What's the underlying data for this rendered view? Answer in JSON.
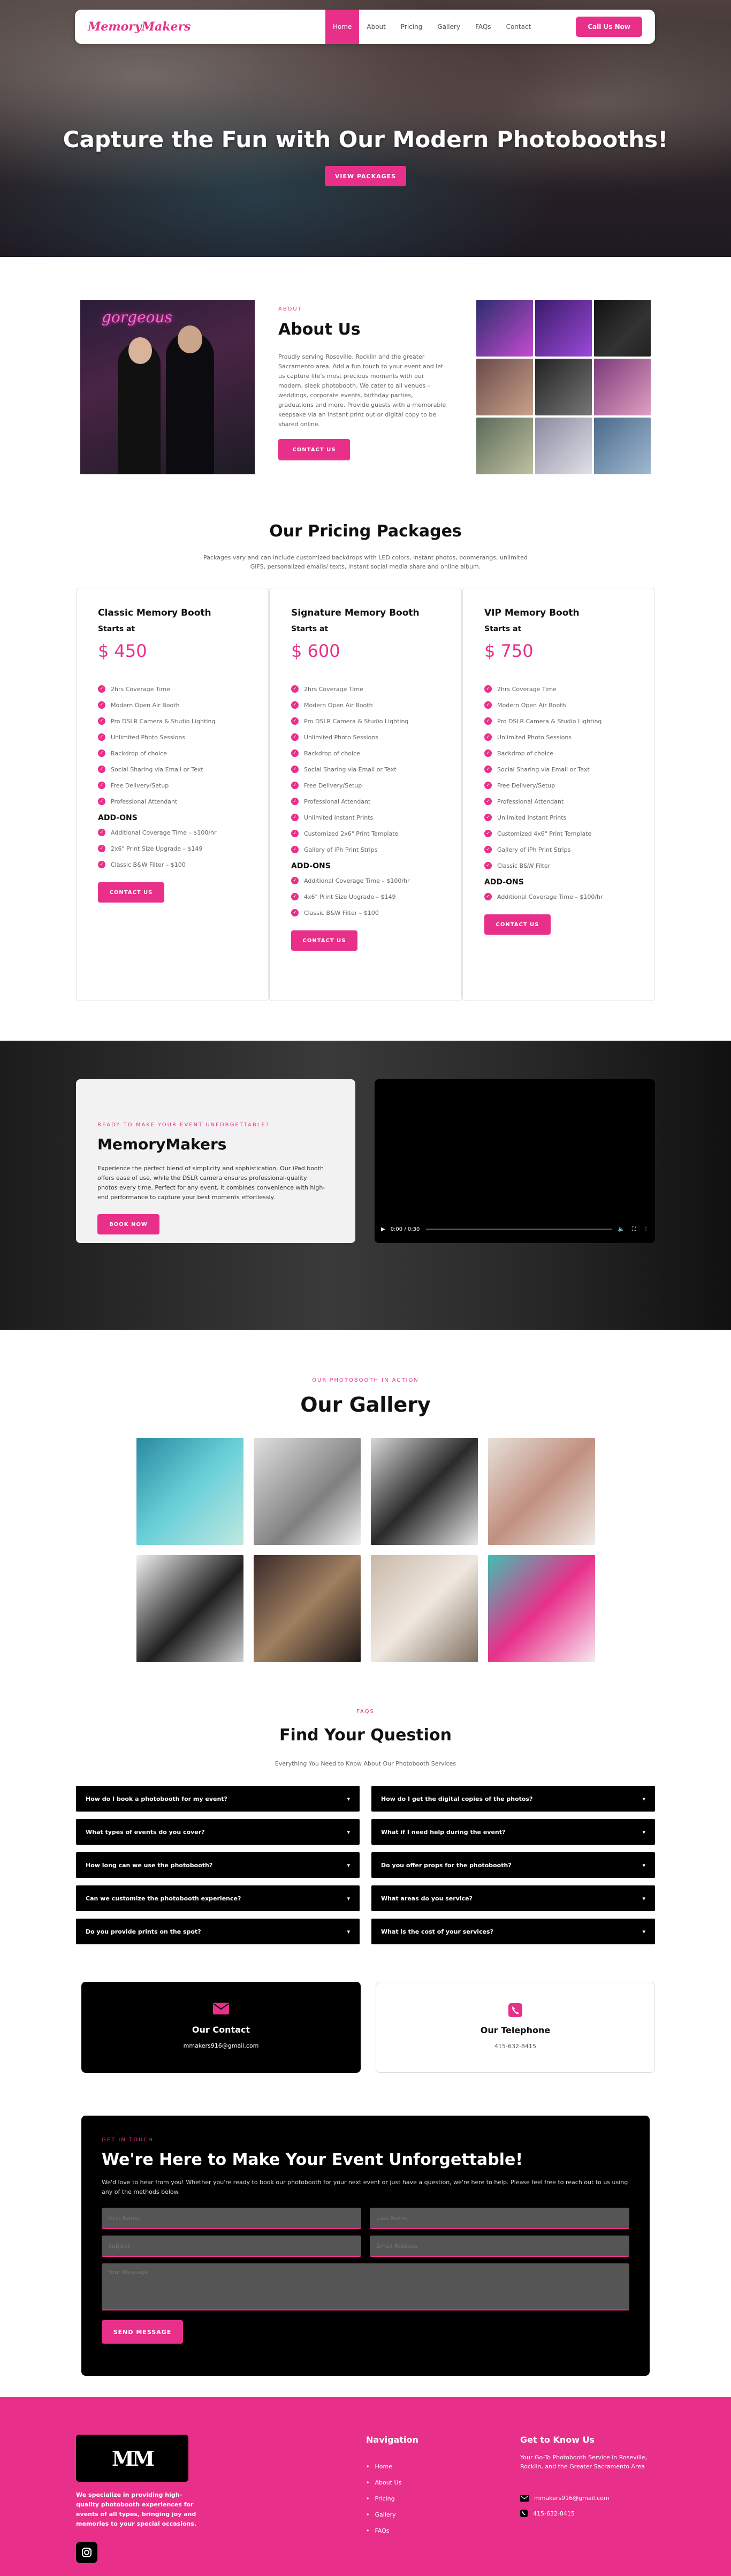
{
  "brand": {
    "name": "MemoryMakers",
    "accent": "#e8308a"
  },
  "nav": {
    "links": [
      "Home",
      "About",
      "Pricing",
      "Gallery",
      "FAQs",
      "Contact"
    ],
    "active": "Home",
    "cta": "Call Us Now"
  },
  "hero": {
    "title": "Capture the Fun with Our Modern Photobooths!",
    "button": "VIEW PACKAGES"
  },
  "about": {
    "eyebrow": "ABOUT",
    "title": "About Us",
    "text": "Proudly serving Roseville, Rocklin and the greater Sacramento area. Add a fun touch to your event and let us capture life's most precious moments with our modern, sleek photobooth. We cater to all venues – weddings, corporate events, birthday parties, graduations and more. Provide guests with a memorable keepsake via an instant print out or digital copy to be shared online.",
    "button": "CONTACT US",
    "neon_sign": "gorgeous"
  },
  "pricing": {
    "title": "Our Pricing Packages",
    "subtitle": "Packages vary and can include customized backdrops with LED colors, instant photos, boomerangs, unlimited GIFS, personalized emails/ texts, instant social media share and online album.",
    "cards": [
      {
        "name": "Classic Memory Booth",
        "starts": "Starts at",
        "price": "$ 450",
        "features": [
          "2hrs Coverage Time",
          "Modern Open Air Booth",
          "Pro DSLR Camera & Studio Lighting",
          "Unlimited Photo Sessions",
          "Backdrop of choice",
          "Social Sharing via Email or Text",
          "Free Delivery/Setup",
          "Professional Attendant"
        ],
        "addons_title": "ADD-ONS",
        "addons": [
          "Additional Coverage Time – $100/hr",
          "2x6\" Print Size Upgrade – $149",
          "Classic B&W Filter – $100"
        ],
        "button": "CONTACT US"
      },
      {
        "name": "Signature Memory Booth",
        "starts": "Starts at",
        "price": "$ 600",
        "features": [
          "2hrs Coverage Time",
          "Modern Open Air Booth",
          "Pro DSLR Camera & Studio Lighting",
          "Unlimited Photo Sessions",
          "Backdrop of choice",
          "Social Sharing via Email or Text",
          "Free Delivery/Setup",
          "Professional Attendant",
          "Unlimited Instant Prints",
          "Customized 2x6\" Print Template",
          "Gallery of iPh Print Strips"
        ],
        "addons_title": "ADD-ONS",
        "addons": [
          "Additional Coverage Time – $100/hr",
          "4x6\" Print Size Upgrade – $149",
          "Classic B&W Filter – $100"
        ],
        "button": "CONTACT US"
      },
      {
        "name": "VIP Memory Booth",
        "starts": "Starts at",
        "price": "$ 750",
        "features": [
          "2hrs Coverage Time",
          "Modern Open Air Booth",
          "Pro DSLR Camera & Studio Lighting",
          "Unlimited Photo Sessions",
          "Backdrop of choice",
          "Social Sharing via Email or Text",
          "Free Delivery/Setup",
          "Professional Attendant",
          "Unlimited Instant Prints",
          "Customized 4x6\" Print Template",
          "Gallery of iPh Print Strips",
          "Classic B&W Filter"
        ],
        "addons_title": "ADD-ONS",
        "addons": [
          "Additional Coverage Time – $100/hr"
        ],
        "button": "CONTACT US"
      }
    ]
  },
  "video": {
    "eyebrow": "READY TO MAKE YOUR EVENT UNFORGETTABLE?",
    "title": "MemoryMakers",
    "text": "Experience the perfect blend of simplicity and sophistication. Our iPad booth offers ease of use, while the DSLR camera ensures professional-quality photos every time. Perfect for any event, it combines convenience with high-end performance to capture your best moments effortlessly.",
    "button": "BOOK NOW",
    "time": "0:00 / 0:30"
  },
  "gallery": {
    "eyebrow": "OUR PHOTOBOOTH IN ACTION",
    "title": "Our Gallery"
  },
  "faq": {
    "eyebrow": "FAQS",
    "title": "Find Your Question",
    "subtitle": "Everything You Need to Know About Our Photobooth Services",
    "left": [
      "How do I book a photobooth for my event?",
      "What types of events do you cover?",
      "How long can we use the photobooth?",
      "Can we customize the photobooth experience?",
      "Do you provide prints on the spot?"
    ],
    "right": [
      "How do I get the digital copies of the photos?",
      "What if I need help during the event?",
      "Do you offer props for the photobooth?",
      "What areas do you service?",
      "What is the cost of your services?"
    ]
  },
  "contact_cards": [
    {
      "title": "Our Contact",
      "value": "mmakers916@gmail.com"
    },
    {
      "title": "Our Telephone",
      "value": "415-632-8415"
    }
  ],
  "form": {
    "eyebrow": "GET IN TOUCH",
    "title": "We're Here to Make Your Event Unforgettable!",
    "text": "We'd love to hear from you! Whether you're ready to book our photobooth for your next event or just have a question, we're here to help. Please feel free to reach out to us using any of the methods below.",
    "first_name": "First Name",
    "last_name": "Last Name",
    "subject": "Subject",
    "email": "Email Address",
    "message": "Your Message",
    "button": "SEND MESSAGE"
  },
  "footer": {
    "logo_text": "MM",
    "description": "We specialize in providing high-quality photobooth experiences for events of all types, bringing joy and memories to your special occasions.",
    "nav_title": "Navigation",
    "nav": [
      "Home",
      "About Us",
      "Pricing",
      "Gallery",
      "FAQs"
    ],
    "know_title": "Get to Know Us",
    "know_text": "Your Go-To Photobooth Service in Roseville, Rocklin, and the Greater Sacramento Area",
    "email": "mmakers916@gmail.com",
    "phone": "415-632-8415"
  }
}
